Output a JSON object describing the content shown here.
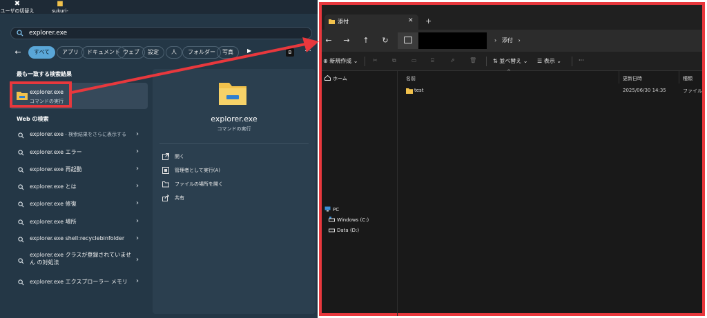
{
  "desktop": {
    "icons": [
      {
        "label": "ユーザの切替え",
        "icon": "user-switch-icon"
      },
      {
        "label": "sukuri-",
        "icon": "folder-icon"
      }
    ]
  },
  "search": {
    "query": "explorer.exe",
    "filters": [
      "すべて",
      "アプリ",
      "ドキュメント",
      "ウェブ",
      "設定",
      "人",
      "フォルダー",
      "写真"
    ],
    "active_filter": "すべて",
    "more_label": "···",
    "badge": "B"
  },
  "best_match": {
    "heading": "最も一致する検索結果",
    "title": "explorer.exe",
    "subtitle": "コマンドの実行"
  },
  "web": {
    "heading": "Web の検索",
    "items": [
      {
        "text": "explorer.exe",
        "sub": " - 検索結果をさらに表示する"
      },
      {
        "text": "explorer.exe エラー"
      },
      {
        "text": "explorer.exe 再起動"
      },
      {
        "text": "explorer.exe とは"
      },
      {
        "text": "explorer.exe 修復"
      },
      {
        "text": "explorer.exe 場所"
      },
      {
        "text": "explorer.exe shell:recyclebinfolder"
      },
      {
        "text": "explorer.exe クラスが登録されていません の対処法"
      },
      {
        "text": "explorer.exe エクスプローラー メモリ"
      }
    ]
  },
  "detail": {
    "title": "explorer.exe",
    "subtitle": "コマンドの実行",
    "actions": [
      {
        "label": "開く",
        "icon": "open-icon"
      },
      {
        "label": "管理者として実行(A)",
        "icon": "admin-shield-icon"
      },
      {
        "label": "ファイルの場所を開く",
        "icon": "folder-open-icon"
      },
      {
        "label": "共有",
        "icon": "share-icon"
      }
    ]
  },
  "explorer": {
    "tab_title": "添付",
    "breadcrumb": "添付",
    "toolbar": {
      "new_label": "新規作成",
      "sort_label": "並べ替え",
      "view_label": "表示",
      "more_label": "···"
    },
    "nav": {
      "home": "ホーム",
      "pc": "PC",
      "drives": [
        "Windows (C:)",
        "Data (D:)"
      ]
    },
    "columns": [
      "名前",
      "更新日時",
      "種類"
    ],
    "files": [
      {
        "name": "test",
        "modified": "2025/06/30 14:35",
        "type": "ファイル フォルダー"
      }
    ]
  },
  "colors": {
    "accent": "#5aa7d8",
    "annotation": "#e8383d",
    "folder": "#f2c24c"
  }
}
